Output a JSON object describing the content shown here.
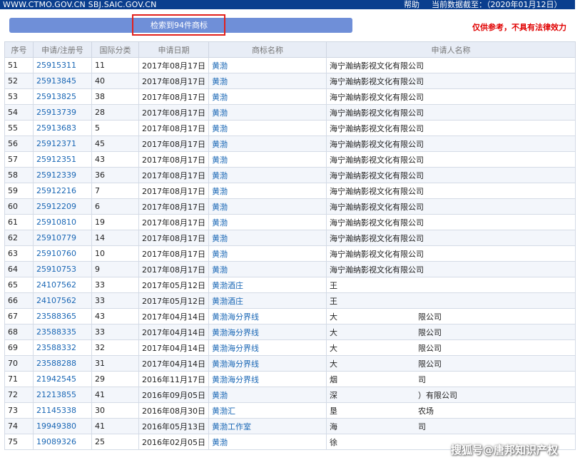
{
  "topbar": {
    "site_urls": "WWW.CTMO.GOV.CN SBJ.SAIC.GOV.CN",
    "help": "帮助",
    "data_date": "当前数据截至：（2020年01月12日）"
  },
  "result": {
    "count_text": "检索到94件商标"
  },
  "disclaimer": "仅供参考，不具有法律效力",
  "table": {
    "headers": [
      "序号",
      "申请/注册号",
      "国际分类",
      "申请日期",
      "商标名称",
      "申请人名称"
    ],
    "rows": [
      {
        "no": "51",
        "reg": "25915311",
        "cls": "11",
        "date": "2017年08月17日",
        "name": "黄渤",
        "applicant": "海宁瀚纳影视文化有限公司",
        "applicant2": ""
      },
      {
        "no": "52",
        "reg": "25913845",
        "cls": "40",
        "date": "2017年08月17日",
        "name": "黄渤",
        "applicant": "海宁瀚纳影视文化有限公司",
        "applicant2": ""
      },
      {
        "no": "53",
        "reg": "25913825",
        "cls": "38",
        "date": "2017年08月17日",
        "name": "黄渤",
        "applicant": "海宁瀚纳影视文化有限公司",
        "applicant2": ""
      },
      {
        "no": "54",
        "reg": "25913739",
        "cls": "28",
        "date": "2017年08月17日",
        "name": "黄渤",
        "applicant": "海宁瀚纳影视文化有限公司",
        "applicant2": ""
      },
      {
        "no": "55",
        "reg": "25913683",
        "cls": "5",
        "date": "2017年08月17日",
        "name": "黄渤",
        "applicant": "海宁瀚纳影视文化有限公司",
        "applicant2": ""
      },
      {
        "no": "56",
        "reg": "25912371",
        "cls": "45",
        "date": "2017年08月17日",
        "name": "黄渤",
        "applicant": "海宁瀚纳影视文化有限公司",
        "applicant2": ""
      },
      {
        "no": "57",
        "reg": "25912351",
        "cls": "43",
        "date": "2017年08月17日",
        "name": "黄渤",
        "applicant": "海宁瀚纳影视文化有限公司",
        "applicant2": ""
      },
      {
        "no": "58",
        "reg": "25912339",
        "cls": "36",
        "date": "2017年08月17日",
        "name": "黄渤",
        "applicant": "海宁瀚纳影视文化有限公司",
        "applicant2": ""
      },
      {
        "no": "59",
        "reg": "25912216",
        "cls": "7",
        "date": "2017年08月17日",
        "name": "黄渤",
        "applicant": "海宁瀚纳影视文化有限公司",
        "applicant2": ""
      },
      {
        "no": "60",
        "reg": "25912209",
        "cls": "6",
        "date": "2017年08月17日",
        "name": "黄渤",
        "applicant": "海宁瀚纳影视文化有限公司",
        "applicant2": ""
      },
      {
        "no": "61",
        "reg": "25910810",
        "cls": "19",
        "date": "2017年08月17日",
        "name": "黄渤",
        "applicant": "海宁瀚纳影视文化有限公司",
        "applicant2": ""
      },
      {
        "no": "62",
        "reg": "25910779",
        "cls": "14",
        "date": "2017年08月17日",
        "name": "黄渤",
        "applicant": "海宁瀚纳影视文化有限公司",
        "applicant2": ""
      },
      {
        "no": "63",
        "reg": "25910760",
        "cls": "10",
        "date": "2017年08月17日",
        "name": "黄渤",
        "applicant": "海宁瀚纳影视文化有限公司",
        "applicant2": ""
      },
      {
        "no": "64",
        "reg": "25910753",
        "cls": "9",
        "date": "2017年08月17日",
        "name": "黄渤",
        "applicant": "海宁瀚纳影视文化有限公司",
        "applicant2": ""
      },
      {
        "no": "65",
        "reg": "24107562",
        "cls": "33",
        "date": "2017年05月12日",
        "name": "黄渤酒庄",
        "applicant": "王",
        "applicant2": ""
      },
      {
        "no": "66",
        "reg": "24107562",
        "cls": "33",
        "date": "2017年05月12日",
        "name": "黄渤酒庄",
        "applicant": "王",
        "applicant2": ""
      },
      {
        "no": "67",
        "reg": "23588365",
        "cls": "43",
        "date": "2017年04月14日",
        "name": "黄渤海分界线",
        "applicant": "大",
        "applicant2": "限公司"
      },
      {
        "no": "68",
        "reg": "23588335",
        "cls": "33",
        "date": "2017年04月14日",
        "name": "黄渤海分界线",
        "applicant": "大",
        "applicant2": "限公司"
      },
      {
        "no": "69",
        "reg": "23588332",
        "cls": "32",
        "date": "2017年04月14日",
        "name": "黄渤海分界线",
        "applicant": "大",
        "applicant2": "限公司"
      },
      {
        "no": "70",
        "reg": "23588288",
        "cls": "31",
        "date": "2017年04月14日",
        "name": "黄渤海分界线",
        "applicant": "大",
        "applicant2": "限公司"
      },
      {
        "no": "71",
        "reg": "21942545",
        "cls": "29",
        "date": "2016年11月17日",
        "name": "黄渤海分界线",
        "applicant": "烟",
        "applicant2": "司"
      },
      {
        "no": "72",
        "reg": "21213855",
        "cls": "41",
        "date": "2016年09月05日",
        "name": "黄渤",
        "applicant": "深",
        "applicant2": "）有限公司"
      },
      {
        "no": "73",
        "reg": "21145338",
        "cls": "30",
        "date": "2016年08月30日",
        "name": "黄渤汇",
        "applicant": "垦",
        "applicant2": "农场"
      },
      {
        "no": "74",
        "reg": "19949380",
        "cls": "41",
        "date": "2016年05月13日",
        "name": "黄渤工作室",
        "applicant": "海",
        "applicant2": "司"
      },
      {
        "no": "75",
        "reg": "19089326",
        "cls": "25",
        "date": "2016年02月05日",
        "name": "黄渤",
        "applicant": "徐",
        "applicant2": ""
      }
    ]
  },
  "watermark": "搜狐号@唐邦知识产权"
}
